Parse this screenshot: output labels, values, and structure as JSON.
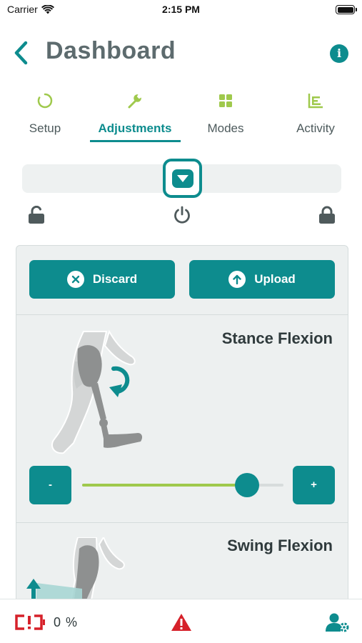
{
  "status_bar": {
    "carrier": "Carrier",
    "time": "2:15 PM"
  },
  "header": {
    "title": "Dashboard",
    "info_glyph": "i"
  },
  "tabs": [
    {
      "label": "Setup",
      "icon": "circle-progress-icon"
    },
    {
      "label": "Adjustments",
      "icon": "wrench-icon",
      "active": true
    },
    {
      "label": "Modes",
      "icon": "grid-icon"
    },
    {
      "label": "Activity",
      "icon": "bar-chart-icon"
    }
  ],
  "panel": {
    "discard_label": "Discard",
    "upload_label": "Upload",
    "sections": [
      {
        "title": "Stance Flexion",
        "minus_label": "-",
        "plus_label": "+",
        "level": 0.82
      },
      {
        "title": "Swing Flexion"
      }
    ]
  },
  "bottom_bar": {
    "battery_percent": "0 %"
  },
  "colors": {
    "accent": "#0d8c8e",
    "green": "#9fc94c",
    "alert_red": "#d6212a"
  }
}
